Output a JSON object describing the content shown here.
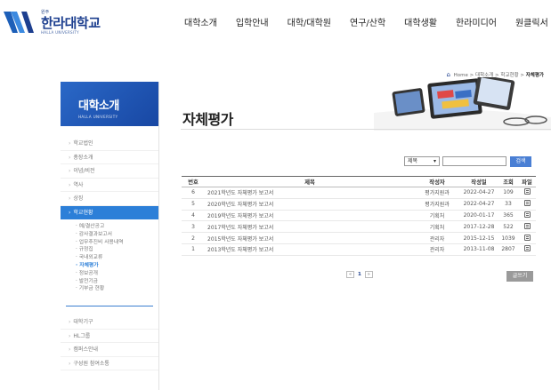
{
  "header": {
    "logo_small": "원주",
    "logo_ko": "한라대학교",
    "logo_en": "HALLA UNIVERSITY",
    "gnb": [
      "대학소개",
      "입학안내",
      "대학/대학원",
      "연구/산학",
      "대학생활",
      "한라미디어",
      "원클릭서"
    ]
  },
  "breadcrumb": {
    "items": [
      "Home",
      "대학소개",
      "학교현황"
    ],
    "current": "자체평가",
    "sep": ">"
  },
  "sidebar": {
    "title": "대학소개",
    "subtitle": "HALLA UNIVERSITY",
    "items_top": [
      "학교법인",
      "총장소개",
      "이념/비전",
      "역사",
      "상징"
    ],
    "active": "학교현황",
    "subitems": [
      "예/결산공고",
      "감사결과보고서",
      "업무추진비 사용내역",
      "규정집",
      "국내외교류",
      "자체평가",
      "정보공개",
      "발전기금",
      "기부금 현황"
    ],
    "active_sub": "자체평가",
    "items_bottom": [
      "대학기구",
      "HL그룹",
      "캠퍼스안내",
      "구성원 참여소통"
    ]
  },
  "main": {
    "title": "자체평가",
    "search": {
      "selected": "제목",
      "value": "",
      "button": "검색"
    },
    "table": {
      "headers": [
        "번호",
        "제목",
        "작성자",
        "작성일",
        "조회",
        "파일"
      ],
      "rows": [
        {
          "no": "6",
          "title": "2021학년도 자체평가 보고서",
          "author": "평가지원과",
          "date": "2022-04-27",
          "views": "109"
        },
        {
          "no": "5",
          "title": "2020학년도 자체평가 보고서",
          "author": "평가지원과",
          "date": "2022-04-27",
          "views": "33"
        },
        {
          "no": "4",
          "title": "2019학년도 자체평가 보고서",
          "author": "기획처",
          "date": "2020-01-17",
          "views": "365"
        },
        {
          "no": "3",
          "title": "2017학년도 자체평가 보고서",
          "author": "기획처",
          "date": "2017-12-28",
          "views": "522"
        },
        {
          "no": "2",
          "title": "2015학년도 자체평가 보고서",
          "author": "관리자",
          "date": "2015-12-15",
          "views": "1039"
        },
        {
          "no": "1",
          "title": "2013학년도 자체평가 보고서",
          "author": "관리자",
          "date": "2013-11-08",
          "views": "2807"
        }
      ]
    },
    "pager": {
      "prev": "«",
      "page": "1",
      "next": "»"
    },
    "write_button": "글쓰기"
  }
}
